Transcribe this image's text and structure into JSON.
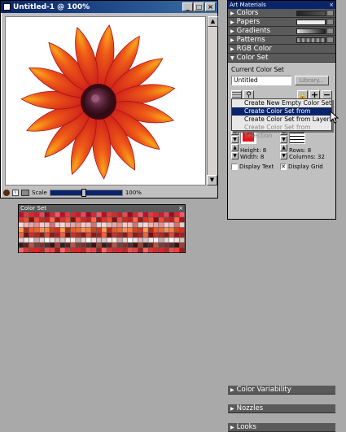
{
  "document": {
    "title": "Untitled-1 @ 100%",
    "scale_label": "Scale",
    "zoom": "100%",
    "min_btn": "_",
    "max_btn": "□",
    "close_btn": "×"
  },
  "panel": {
    "title": "Art Materials",
    "sections": [
      {
        "label": "Colors",
        "swatch": "dark"
      },
      {
        "label": "Papers",
        "swatch": "paper"
      },
      {
        "label": "Gradients",
        "swatch": "gradient"
      },
      {
        "label": "Patterns",
        "swatch": "pattern"
      },
      {
        "label": "RGB Color",
        "swatch": ""
      },
      {
        "label": "Color Set",
        "swatch": ""
      }
    ],
    "color_set": {
      "current_label": "Current Color Set",
      "name_value": "Untitled",
      "library_button": "Library...",
      "swatch_color": "#e8141a",
      "height_label": "Height: 8",
      "width_label": "Width: 8",
      "rows_label": "Rows: 8",
      "columns_label": "Columns: 32",
      "display_text_label": "Display Text",
      "display_grid_label": "Display Grid",
      "display_text_checked": false,
      "display_grid_checked": true
    },
    "bottom_sections": [
      {
        "label": "Color Variability"
      },
      {
        "label": "Nozzles"
      },
      {
        "label": "Looks"
      }
    ]
  },
  "menu": {
    "items": [
      {
        "label": "Create New Empty Color Set",
        "state": "normal"
      },
      {
        "label": "Create Color Set from Image",
        "state": "selected"
      },
      {
        "label": "Create Color Set from Layer",
        "state": "normal"
      },
      {
        "label": "Create Color Set from Selection",
        "state": "disabled"
      }
    ]
  },
  "colorset_window": {
    "title": "Color Set",
    "close_btn": "×"
  },
  "colors": {
    "accent": "#0a246a",
    "petal": "#e1241c",
    "center": "#4a1a2a"
  }
}
